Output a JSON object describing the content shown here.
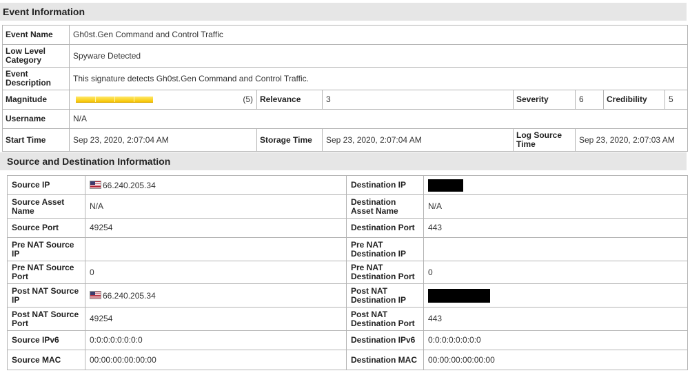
{
  "event_section": {
    "title": "Event Information",
    "event_name_label": "Event Name",
    "event_name": "Gh0st.Gen Command and Control Traffic",
    "low_level_category_label": "Low Level Category",
    "low_level_category": "Spyware Detected",
    "event_description_label": "Event Description",
    "event_description": "This signature detects Gh0st.Gen Command and Control Traffic.",
    "magnitude_label": "Magnitude",
    "magnitude_value": "(5)",
    "magnitude_level": 0.5,
    "relevance_label": "Relevance",
    "relevance": "3",
    "severity_label": "Severity",
    "severity": "6",
    "credibility_label": "Credibility",
    "credibility": "5",
    "username_label": "Username",
    "username": "N/A",
    "start_time_label": "Start Time",
    "start_time": "Sep 23, 2020, 2:07:04 AM",
    "storage_time_label": "Storage Time",
    "storage_time": "Sep 23, 2020, 2:07:04 AM",
    "log_source_time_label": "Log Source Time",
    "log_source_time": "Sep 23, 2020, 2:07:03 AM"
  },
  "src_dst_section": {
    "title": "Source and Destination Information",
    "source_ip_label": "Source IP",
    "source_ip": "66.240.205.34",
    "source_flag_icon": "us-flag-icon",
    "destination_ip_label": "Destination IP",
    "source_asset_name_label": "Source Asset Name",
    "source_asset_name": "N/A",
    "destination_asset_name_label": "Destination Asset Name",
    "destination_asset_name": "N/A",
    "source_port_label": "Source Port",
    "source_port": "49254",
    "destination_port_label": "Destination Port",
    "destination_port": "443",
    "pre_nat_source_ip_label": "Pre NAT Source IP",
    "pre_nat_source_ip": "",
    "pre_nat_destination_ip_label": "Pre NAT Destination IP",
    "pre_nat_destination_ip": "",
    "pre_nat_source_port_label": "Pre NAT Source Port",
    "pre_nat_source_port": "0",
    "pre_nat_destination_port_label": "Pre NAT Destination Port",
    "pre_nat_destination_port": "0",
    "post_nat_source_ip_label": "Post NAT Source IP",
    "post_nat_source_ip": "66.240.205.34",
    "post_nat_destination_ip_label": "Post NAT Destination IP",
    "post_nat_source_port_label": "Post NAT Source Port",
    "post_nat_source_port": "49254",
    "post_nat_destination_port_label": "Post NAT Destination Port",
    "post_nat_destination_port": "443",
    "source_ipv6_label": "Source IPv6",
    "source_ipv6": "0:0:0:0:0:0:0:0",
    "destination_ipv6_label": "Destination IPv6",
    "destination_ipv6": "0:0:0:0:0:0:0:0",
    "source_mac_label": "Source MAC",
    "source_mac": "00:00:00:00:00:00",
    "destination_mac_label": "Destination MAC",
    "destination_mac": "00:00:00:00:00:00"
  },
  "colors": {
    "section_header_bg": "#e6e6e6",
    "magnitude_bar": "#f6c400",
    "redaction": "#000000"
  }
}
